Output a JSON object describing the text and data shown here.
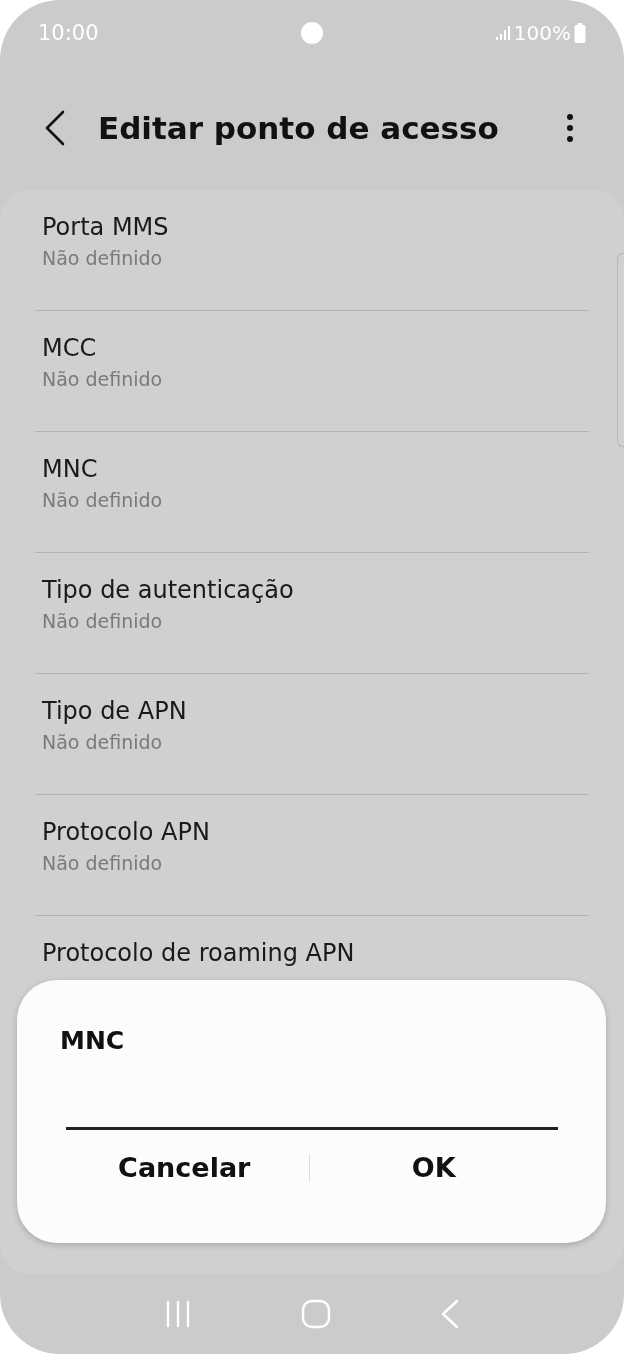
{
  "status_bar": {
    "time": "10:00",
    "battery": "100%"
  },
  "header": {
    "title": "Editar ponto de acesso"
  },
  "settings": [
    {
      "title": "Porta MMS",
      "value": "Não definido"
    },
    {
      "title": "MCC",
      "value": "Não definido"
    },
    {
      "title": "MNC",
      "value": "Não definido"
    },
    {
      "title": "Tipo de autenticação",
      "value": "Não definido"
    },
    {
      "title": "Tipo de APN",
      "value": "Não definido"
    },
    {
      "title": "Protocolo APN",
      "value": "Não definido"
    },
    {
      "title": "Protocolo de roaming APN"
    }
  ],
  "dialog": {
    "title": "MNC",
    "buttons": [
      "Cancelar",
      "OK"
    ]
  }
}
